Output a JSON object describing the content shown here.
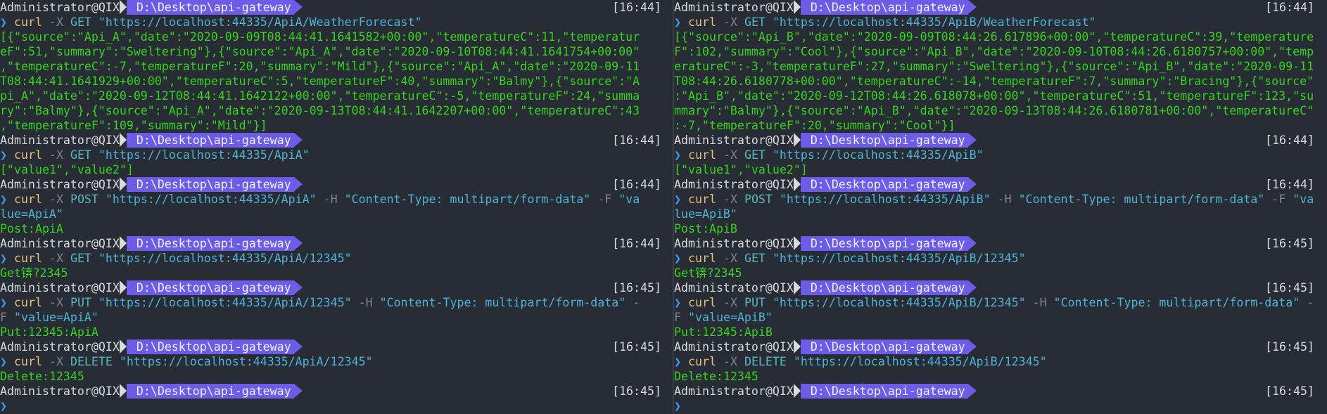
{
  "left": {
    "blocks": [
      {
        "head": "Administrator@QIX",
        "path": "D:\\Desktop\\api-gateway",
        "time": "[16:44]",
        "cmd": [
          "curl",
          "-X",
          "GET",
          "\"https://localhost:44335/ApiA/WeatherForecast\""
        ],
        "cmd_cont": [],
        "output": [
          "[{\"source\":\"Api_A\",\"date\":\"2020-09-09T08:44:41.1641582+00:00\",\"temperatureC\":11,\"temperatur",
          "eF\":51,\"summary\":\"Sweltering\"},{\"source\":\"Api_A\",\"date\":\"2020-09-10T08:44:41.1641754+00:00\"",
          ",\"temperatureC\":-7,\"temperatureF\":20,\"summary\":\"Mild\"},{\"source\":\"Api_A\",\"date\":\"2020-09-11",
          "T08:44:41.1641929+00:00\",\"temperatureC\":5,\"temperatureF\":40,\"summary\":\"Balmy\"},{\"source\":\"A",
          "pi_A\",\"date\":\"2020-09-12T08:44:41.1642122+00:00\",\"temperatureC\":-5,\"temperatureF\":24,\"summa",
          "ry\":\"Balmy\"},{\"source\":\"Api_A\",\"date\":\"2020-09-13T08:44:41.1642207+00:00\",\"temperatureC\":43",
          ",\"temperatureF\":109,\"summary\":\"Mild\"}]"
        ]
      },
      {
        "head": "Administrator@QIX",
        "path": "D:\\Desktop\\api-gateway",
        "time": "[16:44]",
        "cmd": [
          "curl",
          "-X",
          "GET",
          "\"https://localhost:44335/ApiA\""
        ],
        "cmd_cont": [],
        "output": [
          "[\"value1\",\"value2\"]"
        ]
      },
      {
        "head": "Administrator@QIX",
        "path": "D:\\Desktop\\api-gateway",
        "time": "[16:44]",
        "cmd": [
          "curl",
          "-X",
          "POST",
          "\"https://localhost:44335/ApiA\"",
          "-H",
          "\"Content-Type: multipart/form-data\"",
          "-F",
          "\"va"
        ],
        "cmd_cont": [
          "lue=ApiA\""
        ],
        "output": [
          "Post:ApiA"
        ]
      },
      {
        "head": "Administrator@QIX",
        "path": "D:\\Desktop\\api-gateway",
        "time": "[16:44]",
        "cmd": [
          "curl",
          "-X",
          "GET",
          "\"https://localhost:44335/ApiA/12345\""
        ],
        "cmd_cont": [],
        "output": [
          "Get锛?2345"
        ]
      },
      {
        "head": "Administrator@QIX",
        "path": "D:\\Desktop\\api-gateway",
        "time": "[16:45]",
        "cmd": [
          "curl",
          "-X",
          "PUT",
          "\"https://localhost:44335/ApiA/12345\"",
          "-H",
          "\"Content-Type: multipart/form-data\"",
          "-"
        ],
        "cmd_cont": [
          "F",
          "\"value=ApiA\""
        ],
        "output": [
          "Put:12345:ApiA"
        ]
      },
      {
        "head": "Administrator@QIX",
        "path": "D:\\Desktop\\api-gateway",
        "time": "[16:45]",
        "cmd": [
          "curl",
          "-X",
          "DELETE",
          "\"https://localhost:44335/ApiA/12345\""
        ],
        "cmd_cont": [],
        "output": [
          "Delete:12345"
        ]
      },
      {
        "head": "Administrator@QIX",
        "path": "D:\\Desktop\\api-gateway",
        "time": "[16:45]",
        "cmd": [],
        "cmd_cont": [],
        "output": []
      }
    ]
  },
  "right": {
    "blocks": [
      {
        "head": "Administrator@QIX",
        "path": "D:\\Desktop\\api-gateway",
        "time": "[16:44]",
        "cmd": [
          "curl",
          "-X",
          "GET",
          "\"https://localhost:44335/ApiB/WeatherForecast\""
        ],
        "cmd_cont": [],
        "output": [
          "[{\"source\":\"Api_B\",\"date\":\"2020-09-09T08:44:26.617896+00:00\",\"temperatureC\":39,\"temperature",
          "F\":102,\"summary\":\"Cool\"},{\"source\":\"Api_B\",\"date\":\"2020-09-10T08:44:26.6180757+00:00\",\"temp",
          "eratureC\":-3,\"temperatureF\":27,\"summary\":\"Sweltering\"},{\"source\":\"Api_B\",\"date\":\"2020-09-11",
          "T08:44:26.6180778+00:00\",\"temperatureC\":-14,\"temperatureF\":7,\"summary\":\"Bracing\"},{\"source\"",
          ":\"Api_B\",\"date\":\"2020-09-12T08:44:26.618078+00:00\",\"temperatureC\":51,\"temperatureF\":123,\"su",
          "mmary\":\"Balmy\"},{\"source\":\"Api_B\",\"date\":\"2020-09-13T08:44:26.6180781+00:00\",\"temperatureC\"",
          ":-7,\"temperatureF\":20,\"summary\":\"Cool\"}]"
        ]
      },
      {
        "head": "Administrator@QIX",
        "path": "D:\\Desktop\\api-gateway",
        "time": "[16:44]",
        "cmd": [
          "curl",
          "-X",
          "GET",
          "\"https://localhost:44335/ApiB\""
        ],
        "cmd_cont": [],
        "output": [
          "[\"value1\",\"value2\"]"
        ]
      },
      {
        "head": "Administrator@QIX",
        "path": "D:\\Desktop\\api-gateway",
        "time": "[16:44]",
        "cmd": [
          "curl",
          "-X",
          "POST",
          "\"https://localhost:44335/ApiB\"",
          "-H",
          "\"Content-Type: multipart/form-data\"",
          "-F",
          "\"va"
        ],
        "cmd_cont": [
          "lue=ApiB\""
        ],
        "output": [
          "Post:ApiB"
        ]
      },
      {
        "head": "Administrator@QIX",
        "path": "D:\\Desktop\\api-gateway",
        "time": "[16:45]",
        "cmd": [
          "curl",
          "-X",
          "GET",
          "\"https://localhost:44335/ApiB/12345\""
        ],
        "cmd_cont": [],
        "output": [
          "Get锛?2345"
        ]
      },
      {
        "head": "Administrator@QIX",
        "path": "D:\\Desktop\\api-gateway",
        "time": "[16:45]",
        "cmd": [
          "curl",
          "-X",
          "PUT",
          "\"https://localhost:44335/ApiB/12345\"",
          "-H",
          "\"Content-Type: multipart/form-data\"",
          "-"
        ],
        "cmd_cont": [
          "F",
          "\"value=ApiB\""
        ],
        "output": [
          "Put:12345:ApiB"
        ]
      },
      {
        "head": "Administrator@QIX",
        "path": "D:\\Desktop\\api-gateway",
        "time": "[16:45]",
        "cmd": [
          "curl",
          "-X",
          "DELETE",
          "\"https://localhost:44335/ApiB/12345\""
        ],
        "cmd_cont": [],
        "output": [
          "Delete:12345"
        ]
      },
      {
        "head": "Administrator@QIX",
        "path": "D:\\Desktop\\api-gateway",
        "time": "[16:45]",
        "cmd": [],
        "cmd_cont": [],
        "output": []
      }
    ]
  },
  "prompt_arrow": "❯",
  "colors": {
    "background": "#282c34",
    "path_segment": "#6c5ce7",
    "output_green": "#37d21f",
    "command_yellow": "#e5c07b",
    "string_cyan": "#4fb3d8",
    "arrow_blue": "#3aa1ff"
  }
}
